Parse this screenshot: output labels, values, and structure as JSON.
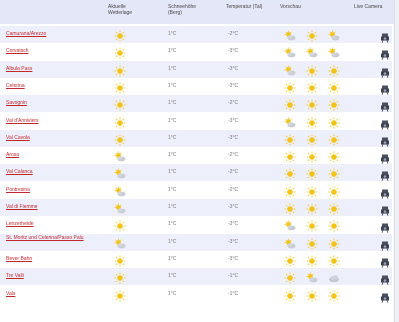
{
  "columns": {
    "current": "Aktuelle Wetterlage",
    "snow": "Schneehöhe (Berg)",
    "temp": "Temperatur (Tal)",
    "forecast": "Vorschau",
    "cam": "Live Camera"
  },
  "colors": {
    "place_link": "#c0272d",
    "header_bg": "#e4e7f7",
    "row_alt": "#edf0fb",
    "sun": "#f2c318"
  },
  "rows": [
    {
      "place": "Camurana/Arezzo",
      "snow": "1°C",
      "temp": "-2°C",
      "current": "sun",
      "forecast": [
        "partly",
        "sun",
        "partly"
      ]
    },
    {
      "place": "Corvatsch",
      "snow": "1°C",
      "temp": "-3°C",
      "current": "sun",
      "forecast": [
        "partly",
        "partly",
        "partly"
      ]
    },
    {
      "place": "Albula Pass",
      "snow": "1°C",
      "temp": "-3°C",
      "current": "sun",
      "forecast": [
        "partly",
        "sun",
        "sun"
      ]
    },
    {
      "place": "Celerina",
      "snow": "1°C",
      "temp": "-3°C",
      "current": "sun",
      "forecast": [
        "sun",
        "sun",
        "sun"
      ]
    },
    {
      "place": "Savognin",
      "snow": "1°C",
      "temp": "-2°C",
      "current": "sun",
      "forecast": [
        "sun",
        "sun",
        "sun"
      ]
    },
    {
      "place": "Val d'Anniviers",
      "snow": "1°C",
      "temp": "-3°C",
      "current": "sun",
      "forecast": [
        "partly",
        "sun",
        "sun"
      ]
    },
    {
      "place": "Val Cavola",
      "snow": "1°C",
      "temp": "-3°C",
      "current": "sun",
      "forecast": [
        "sun",
        "sun",
        "sun"
      ]
    },
    {
      "place": "Arosa",
      "snow": "1°C",
      "temp": "-2°C",
      "current": "partly",
      "forecast": [
        "sun",
        "sun",
        "sun"
      ]
    },
    {
      "place": "Val Calanca",
      "snow": "1°C",
      "temp": "-2°C",
      "current": "partly",
      "forecast": [
        "sun",
        "sun",
        "sun"
      ]
    },
    {
      "place": "Pontresina",
      "snow": "1°C",
      "temp": "-2°C",
      "current": "partly",
      "forecast": [
        "sun",
        "sun",
        "sun"
      ]
    },
    {
      "place": "Val di Fiemme",
      "snow": "1°C",
      "temp": "-3°C",
      "current": "partly",
      "forecast": [
        "sun",
        "sun",
        "sun"
      ]
    },
    {
      "place": "Lenzerheide",
      "snow": "1°C",
      "temp": "-3°C",
      "current": "sun",
      "forecast": [
        "partly",
        "sun",
        "sun"
      ]
    },
    {
      "place": "St. Moritz und Celerina/Passo Palu",
      "snow": "1°C",
      "temp": "-3°C",
      "current": "partly",
      "forecast": [
        "partly",
        "sun",
        "sun"
      ]
    },
    {
      "place": "Bever Bahn",
      "snow": "1°C",
      "temp": "-3°C",
      "current": "sun",
      "forecast": [
        "sun",
        "sun",
        "sun"
      ]
    },
    {
      "place": "Tre Valli",
      "snow": "1°C",
      "temp": "-1°C",
      "current": "sun",
      "forecast": [
        "sun",
        "partly",
        "cloud"
      ]
    },
    {
      "place": "Vals",
      "snow": "1°C",
      "temp": "-1°C",
      "current": "sun",
      "forecast": [
        "sun",
        "sun",
        "sun"
      ]
    }
  ]
}
